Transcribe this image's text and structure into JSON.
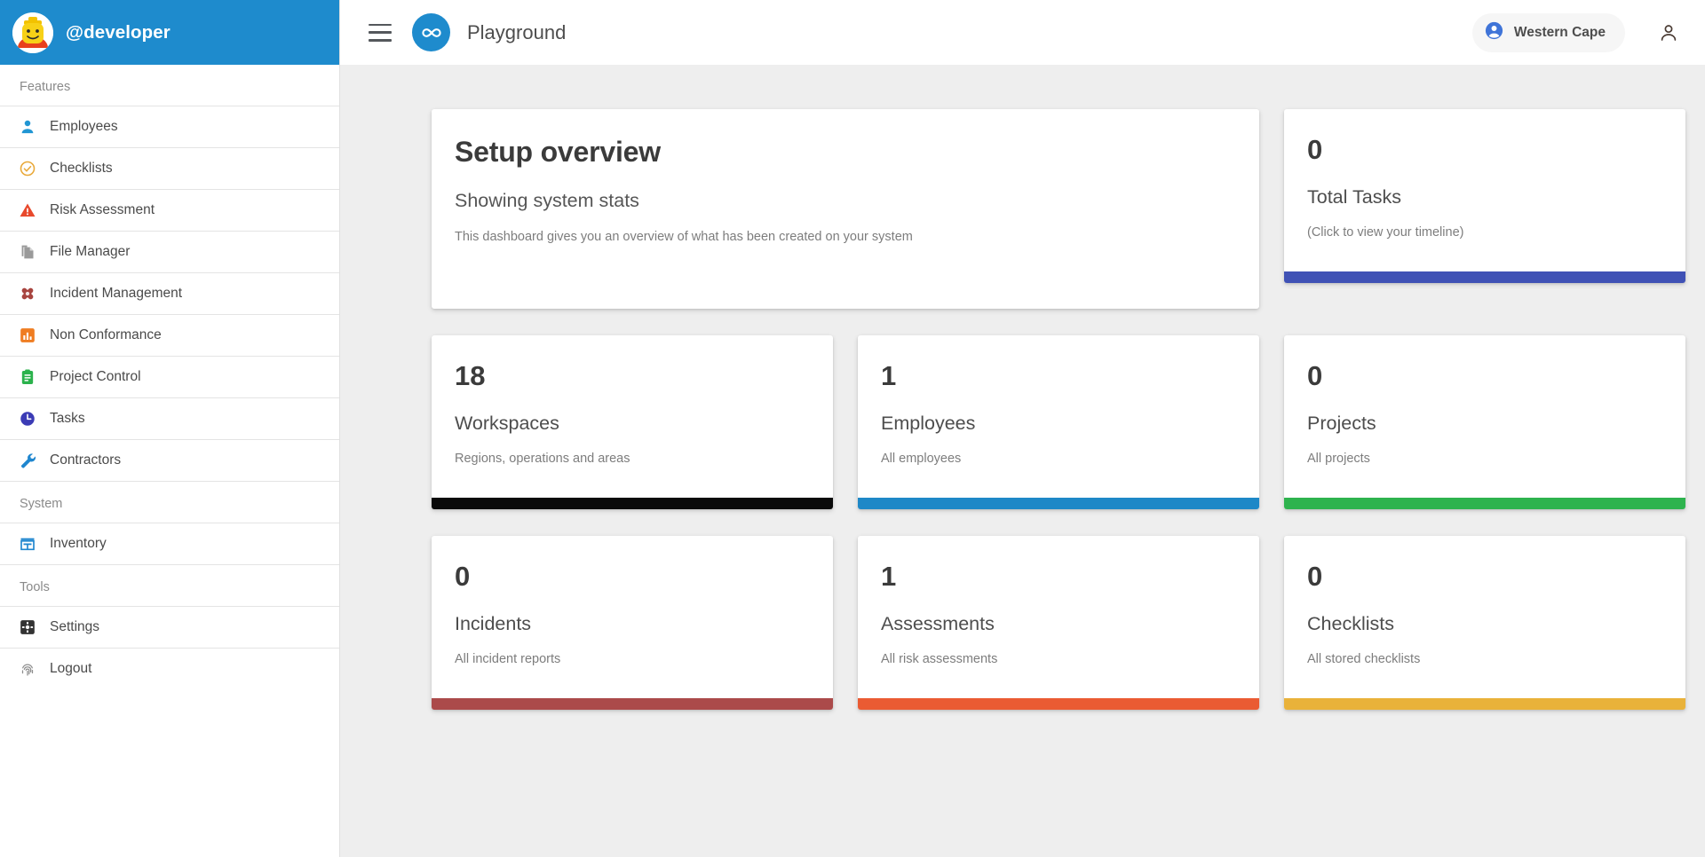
{
  "sidebar": {
    "user": "@developer",
    "avatar": "lego-minifigure-avatar",
    "sections": [
      {
        "label": "Features",
        "items": [
          {
            "label": "Employees",
            "icon": "person-icon",
            "color": "#2196d3"
          },
          {
            "label": "Checklists",
            "icon": "check-circle-icon",
            "color": "#e9a93a"
          },
          {
            "label": "Risk Assessment",
            "icon": "warning-triangle-icon",
            "color": "#e8492c"
          },
          {
            "label": "File Manager",
            "icon": "copy-files-icon",
            "color": "#9a9a9a"
          },
          {
            "label": "Incident Management",
            "icon": "bandage-cross-icon",
            "color": "#a8443f"
          },
          {
            "label": "Non Conformance",
            "icon": "bar-chart-icon",
            "color": "#ef7d22"
          },
          {
            "label": "Project Control",
            "icon": "clipboard-icon",
            "color": "#2bb24c"
          },
          {
            "label": "Tasks",
            "icon": "clock-icon",
            "color": "#3b3bb5"
          },
          {
            "label": "Contractors",
            "icon": "wrench-icon",
            "color": "#1f86cf"
          }
        ]
      },
      {
        "label": "System",
        "items": [
          {
            "label": "Inventory",
            "icon": "storefront-icon",
            "color": "#1f86cf"
          }
        ]
      },
      {
        "label": "Tools",
        "items": [
          {
            "label": "Settings",
            "icon": "gear-square-icon",
            "color": "#333333"
          },
          {
            "label": "Logout",
            "icon": "fingerprint-icon",
            "color": "#8e8e8e"
          }
        ]
      }
    ]
  },
  "topbar": {
    "menu_icon": "hamburger-menu-icon",
    "logo_icon": "infinity-logo-icon",
    "title": "Playground",
    "region": {
      "label": "Western Cape",
      "icon": "account-circle-icon"
    },
    "account_icon": "person-outline-icon"
  },
  "overview": {
    "title": "Setup overview",
    "subtitle": "Showing system stats",
    "description": "This dashboard gives you an overview of what has been created on your system"
  },
  "stats": [
    {
      "value": "0",
      "label": "Total Tasks",
      "desc": "(Click to view your timeline)",
      "bar_color": "#3f51b5"
    },
    {
      "value": "18",
      "label": "Workspaces",
      "desc": "Regions, operations and areas",
      "bar_color": "#0a0a0a"
    },
    {
      "value": "1",
      "label": "Employees",
      "desc": "All employees",
      "bar_color": "#1e88c7"
    },
    {
      "value": "0",
      "label": "Projects",
      "desc": "All projects",
      "bar_color": "#2eb34e"
    },
    {
      "value": "0",
      "label": "Incidents",
      "desc": "All incident reports",
      "bar_color": "#ab4a4a"
    },
    {
      "value": "1",
      "label": "Assessments",
      "desc": "All risk assessments",
      "bar_color": "#ea5b33"
    },
    {
      "value": "0",
      "label": "Checklists",
      "desc": "All stored checklists",
      "bar_color": "#e9b23a"
    }
  ],
  "colors": {
    "sidebar_header": "#1e8bcd",
    "brand": "#1e8bcd",
    "content_bg": "#eeeeee"
  }
}
